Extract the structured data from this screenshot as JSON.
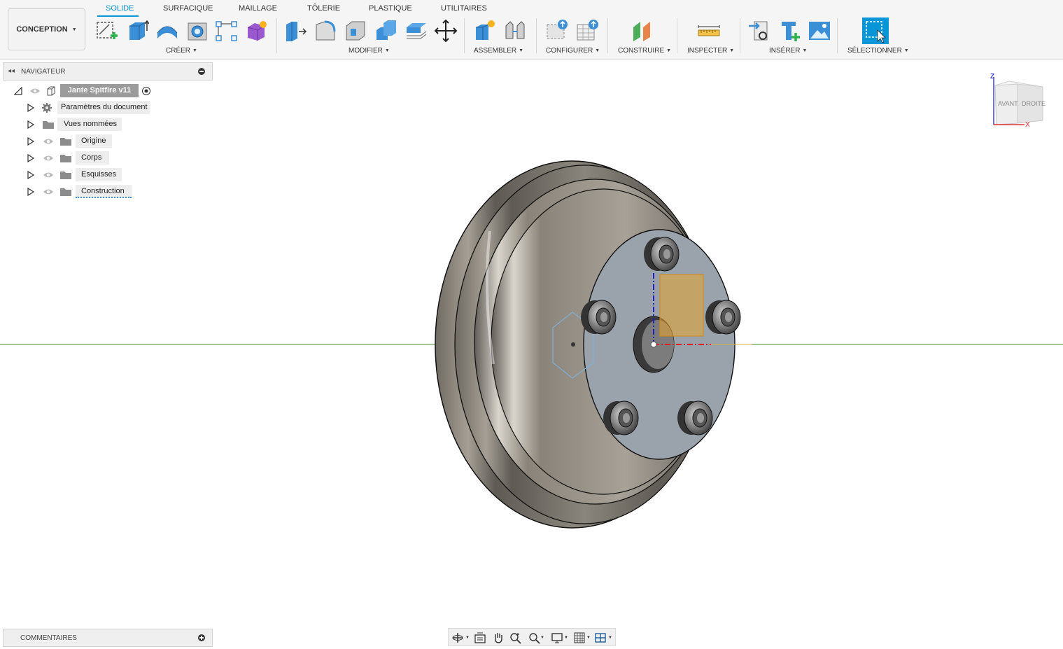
{
  "workspace": {
    "label": "CONCEPTION"
  },
  "tabs": [
    {
      "label": "SOLIDE",
      "active": true
    },
    {
      "label": "SURFACIQUE"
    },
    {
      "label": "MAILLAGE"
    },
    {
      "label": "TÔLERIE"
    },
    {
      "label": "PLASTIQUE"
    },
    {
      "label": "UTILITAIRES"
    }
  ],
  "groups": {
    "creer": "CRÉER",
    "modifier": "MODIFIER",
    "assembler": "ASSEMBLER",
    "configurer": "CONFIGURER",
    "construire": "CONSTRUIRE",
    "inspecter": "INSPECTER",
    "inserer": "INSÉRER",
    "selectionner": "SÉLECTIONNER"
  },
  "navigator": {
    "title": "NAVIGATEUR",
    "root": "Jante Spitfire v11",
    "items": [
      {
        "label": "Paramètres du document",
        "icon": "gear-icon"
      },
      {
        "label": "Vues nommées",
        "icon": "folder-icon"
      },
      {
        "label": "Origine",
        "icon": "folder-icon"
      },
      {
        "label": "Corps",
        "icon": "folder-icon"
      },
      {
        "label": "Esquisses",
        "icon": "folder-icon"
      },
      {
        "label": "Construction",
        "icon": "folder-icon"
      }
    ]
  },
  "comments": {
    "title": "COMMENTAIRES"
  },
  "viewcube": {
    "front": "AVANT",
    "right": "DROITE",
    "z_axis": "Z",
    "x_axis": "X"
  },
  "colors": {
    "accent": "#0696d7",
    "origin_x_axis": "#e02020",
    "origin_z_axis": "#2020c0",
    "ground_line": "#4a8a2a",
    "sketch_plane": "#e7a430"
  }
}
